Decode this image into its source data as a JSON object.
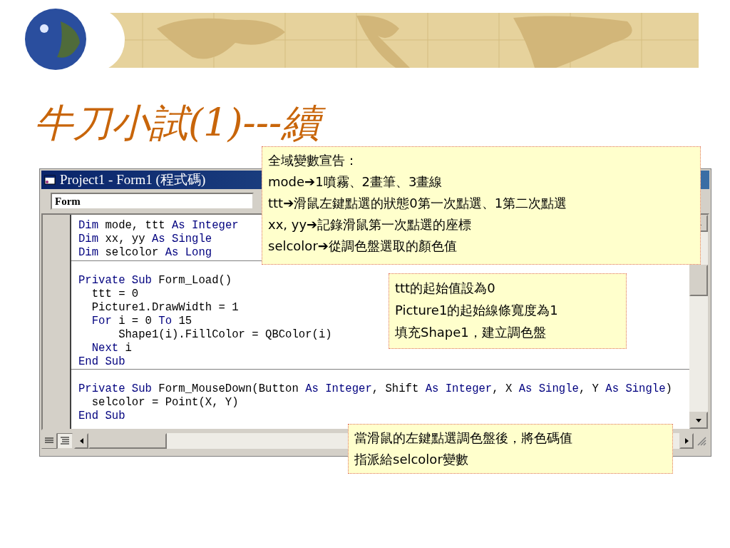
{
  "slide": {
    "title": "牛刀小試(1)---續"
  },
  "code_window": {
    "title": "Project1 - Form1 (程式碼)",
    "object_field": "Form",
    "blocks": [
      {
        "lines": [
          [
            {
              "text": "Dim",
              "kind": "keyword"
            },
            {
              "text": " mode, ttt ",
              "kind": "plain"
            },
            {
              "text": "As Integer",
              "kind": "keyword"
            }
          ],
          [
            {
              "text": "Dim",
              "kind": "keyword"
            },
            {
              "text": " xx, yy ",
              "kind": "plain"
            },
            {
              "text": "As Single",
              "kind": "keyword"
            }
          ],
          [
            {
              "text": "Dim",
              "kind": "keyword"
            },
            {
              "text": " selcolor ",
              "kind": "plain"
            },
            {
              "text": "As Long",
              "kind": "keyword"
            }
          ]
        ]
      },
      {
        "lines": [
          [
            {
              "text": "Private Sub",
              "kind": "keyword"
            },
            {
              "text": " Form_Load()",
              "kind": "plain"
            }
          ],
          [
            {
              "text": "  ttt = 0",
              "kind": "plain"
            }
          ],
          [
            {
              "text": "  Picture1.DrawWidth = 1",
              "kind": "plain"
            }
          ],
          [
            {
              "text": "  For",
              "kind": "keyword"
            },
            {
              "text": " i = 0 ",
              "kind": "plain"
            },
            {
              "text": "To",
              "kind": "keyword"
            },
            {
              "text": " 15",
              "kind": "plain"
            }
          ],
          [
            {
              "text": "      Shape1(i).FillColor = QBColor(i)",
              "kind": "plain"
            }
          ],
          [
            {
              "text": "  Next",
              "kind": "keyword"
            },
            {
              "text": " i",
              "kind": "plain"
            }
          ],
          [
            {
              "text": "End Sub",
              "kind": "keyword"
            }
          ]
        ]
      },
      {
        "lines": [
          [
            {
              "text": "Private Sub",
              "kind": "keyword"
            },
            {
              "text": " Form_MouseDown(Button ",
              "kind": "plain"
            },
            {
              "text": "As Integer",
              "kind": "keyword"
            },
            {
              "text": ", Shift ",
              "kind": "plain"
            },
            {
              "text": "As Integer",
              "kind": "keyword"
            },
            {
              "text": ", X ",
              "kind": "plain"
            },
            {
              "text": "As Single",
              "kind": "keyword"
            },
            {
              "text": ", Y ",
              "kind": "plain"
            },
            {
              "text": "As Single",
              "kind": "keyword"
            },
            {
              "text": ")",
              "kind": "plain"
            }
          ],
          [
            {
              "text": "  selcolor = Point(X, Y)",
              "kind": "plain"
            }
          ],
          [
            {
              "text": "End Sub",
              "kind": "keyword"
            }
          ]
        ]
      }
    ]
  },
  "callouts": [
    {
      "lines": [
        "全域變數宣告：",
        "mode➔1噴霧、2畫筆、3畫線",
        "ttt➔滑鼠左鍵點選的狀態0第一次點選、1第二次點選",
        "xx, yy➔記錄滑鼠第一次點選的座標",
        "selcolor➔從調色盤選取的顏色值"
      ]
    },
    {
      "lines": [
        "ttt的起始值設為0",
        "Picture1的起始線條寬度為1",
        "填充Shape1，建立調色盤"
      ]
    },
    {
      "lines": [
        "當滑鼠的左鍵點選調色盤後，將色碼值",
        "指派給selcolor變數"
      ]
    }
  ]
}
